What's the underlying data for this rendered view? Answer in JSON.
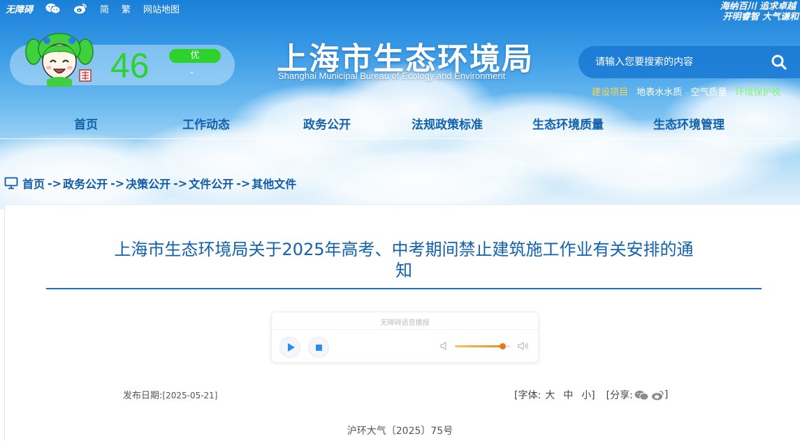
{
  "topbar": {
    "accessible": "无障碍",
    "simplified": "简",
    "traditional": "繁",
    "sitemap": "网站地图",
    "icons": [
      "wechat-icon",
      "weibo-icon"
    ]
  },
  "slogan": {
    "line1": "海纳百川 追求卓越",
    "line2": "开明睿智 大气谦和"
  },
  "aqi": {
    "value": "46",
    "level": "优",
    "sub": "-"
  },
  "site": {
    "title": "上海市生态环境局",
    "subtitle": "Shanghai Municipal Bureau of Ecology and Environment"
  },
  "search": {
    "placeholder": "请输入您要搜索的内容"
  },
  "quicklinks": [
    {
      "label": "建设项目",
      "color": "#f6d84a"
    },
    {
      "label": "地表水水质",
      "color": "#ffffff"
    },
    {
      "label": "空气质量",
      "color": "#ffffff"
    },
    {
      "label": "环境保护税",
      "color": "#7ef07e"
    }
  ],
  "nav": [
    {
      "label": "首页"
    },
    {
      "label": "工作动态"
    },
    {
      "label": "政务公开"
    },
    {
      "label": "法规政策标准"
    },
    {
      "label": "生态环境质量"
    },
    {
      "label": "生态环境管理"
    }
  ],
  "breadcrumb": {
    "items": [
      "首页",
      "政务公开",
      "决策公开",
      "文件公开",
      "其他文件"
    ],
    "separator": "->"
  },
  "article": {
    "title": "上海市生态环境局关于2025年高考、中考期间禁止建筑施工作业有关安排的通知",
    "title_line1": "上海市生态环境局关于2025年高考、中考期间禁止建筑施工作业有关安排的通",
    "title_line2": "知",
    "pub_label": "发布日期:",
    "pub_date": "[2025-05-21]",
    "font_label": "[字体:",
    "font_large": "大",
    "font_medium": "中",
    "font_small": "小]",
    "share_label": "[分享:",
    "share_close": "]",
    "doc_number": "沪环大气〔2025〕75号"
  },
  "player": {
    "label": "无障碍语音播报",
    "volume": 0.85
  }
}
